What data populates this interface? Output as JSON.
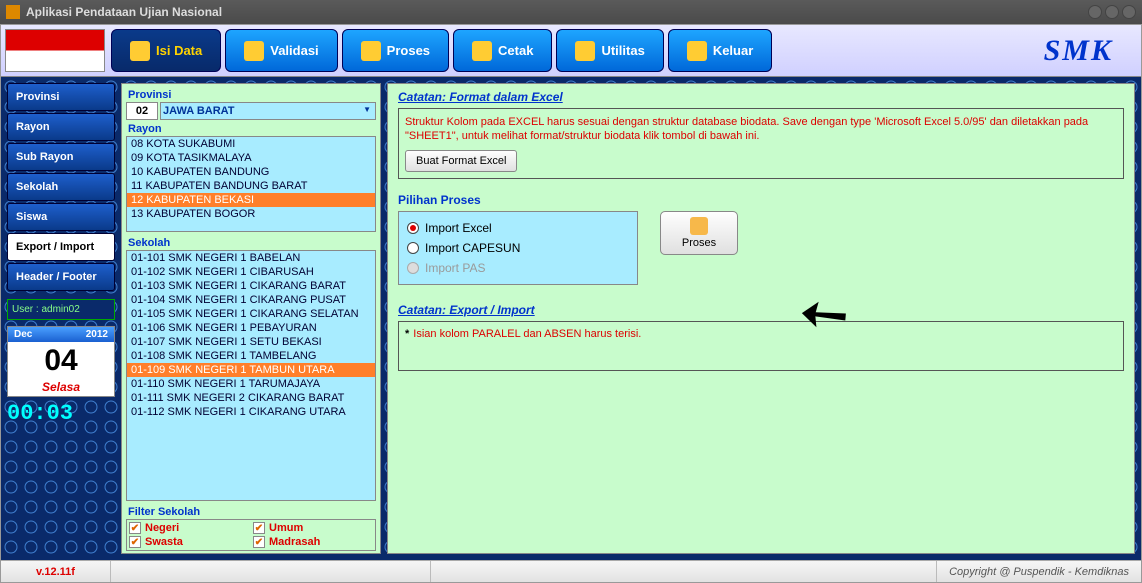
{
  "window": {
    "title": "Aplikasi Pendataan Ujian Nasional"
  },
  "menu": {
    "items": [
      {
        "label": "Isi Data"
      },
      {
        "label": "Validasi"
      },
      {
        "label": "Proses"
      },
      {
        "label": "Cetak"
      },
      {
        "label": "Utilitas"
      },
      {
        "label": "Keluar"
      }
    ],
    "logo": "SMK"
  },
  "nav": {
    "items": [
      {
        "label": "Provinsi"
      },
      {
        "label": "Rayon"
      },
      {
        "label": "Sub Rayon"
      },
      {
        "label": "Sekolah"
      },
      {
        "label": "Siswa"
      },
      {
        "label": "Export / Import"
      },
      {
        "label": "Header / Footer"
      }
    ],
    "userLabel": "User : admin02",
    "cal": {
      "month": "Dec",
      "year": "2012",
      "day": "04",
      "dow": "Selasa"
    },
    "clock": "00:03"
  },
  "provinsi": {
    "sectLabel": "Provinsi",
    "code": "02",
    "name": "JAWA BARAT"
  },
  "rayon": {
    "sectLabel": "Rayon",
    "items": [
      "08   KOTA SUKABUMI",
      "09   KOTA TASIKMALAYA",
      "10   KABUPATEN BANDUNG",
      "11   KABUPATEN BANDUNG BARAT",
      "12   KABUPATEN BEKASI",
      "13   KABUPATEN BOGOR"
    ],
    "selectedIndex": 4
  },
  "sekolah": {
    "sectLabel": "Sekolah",
    "items": [
      "01-101   SMK NEGERI 1 BABELAN",
      "01-102   SMK NEGERI 1 CIBARUSAH",
      "01-103   SMK NEGERI 1 CIKARANG BARAT",
      "01-104   SMK NEGERI 1 CIKARANG PUSAT",
      "01-105   SMK NEGERI 1 CIKARANG SELATAN",
      "01-106   SMK NEGERI 1 PEBAYURAN",
      "01-107   SMK NEGERI 1 SETU BEKASI",
      "01-108   SMK NEGERI 1 TAMBELANG",
      "01-109   SMK NEGERI 1 TAMBUN UTARA",
      "01-110   SMK NEGERI 1 TARUMAJAYA",
      "01-111   SMK NEGERI 2 CIKARANG BARAT",
      "01-112   SMK NEGERI 1 CIKARANG UTARA"
    ],
    "selectedIndex": 8
  },
  "filter": {
    "sectLabel": "Filter Sekolah",
    "opts": [
      "Negeri",
      "Umum",
      "Swasta",
      "Madrasah"
    ]
  },
  "catatanFormat": {
    "title": "Catatan: Format dalam Excel",
    "body": "Struktur Kolom pada EXCEL harus sesuai dengan struktur database biodata. Save dengan type 'Microsoft Excel 5.0/95' dan diletakkan pada \"SHEET1\", untuk melihat format/struktur biodata klik tombol di bawah ini.",
    "btn": "Buat Format Excel"
  },
  "pilihan": {
    "title": "Pilihan Proses",
    "opts": [
      {
        "label": "Import Excel",
        "state": "on"
      },
      {
        "label": "Import CAPESUN",
        "state": "off"
      },
      {
        "label": "Import PAS",
        "state": "disabled"
      }
    ],
    "prosesBtn": "Proses"
  },
  "catatanExport": {
    "title": "Catatan: Export / Import",
    "body": "Isian kolom PARALEL dan ABSEN harus terisi."
  },
  "status": {
    "version": "v.12.11f",
    "copyright": "Copyright @ Puspendik - Kemdiknas"
  }
}
